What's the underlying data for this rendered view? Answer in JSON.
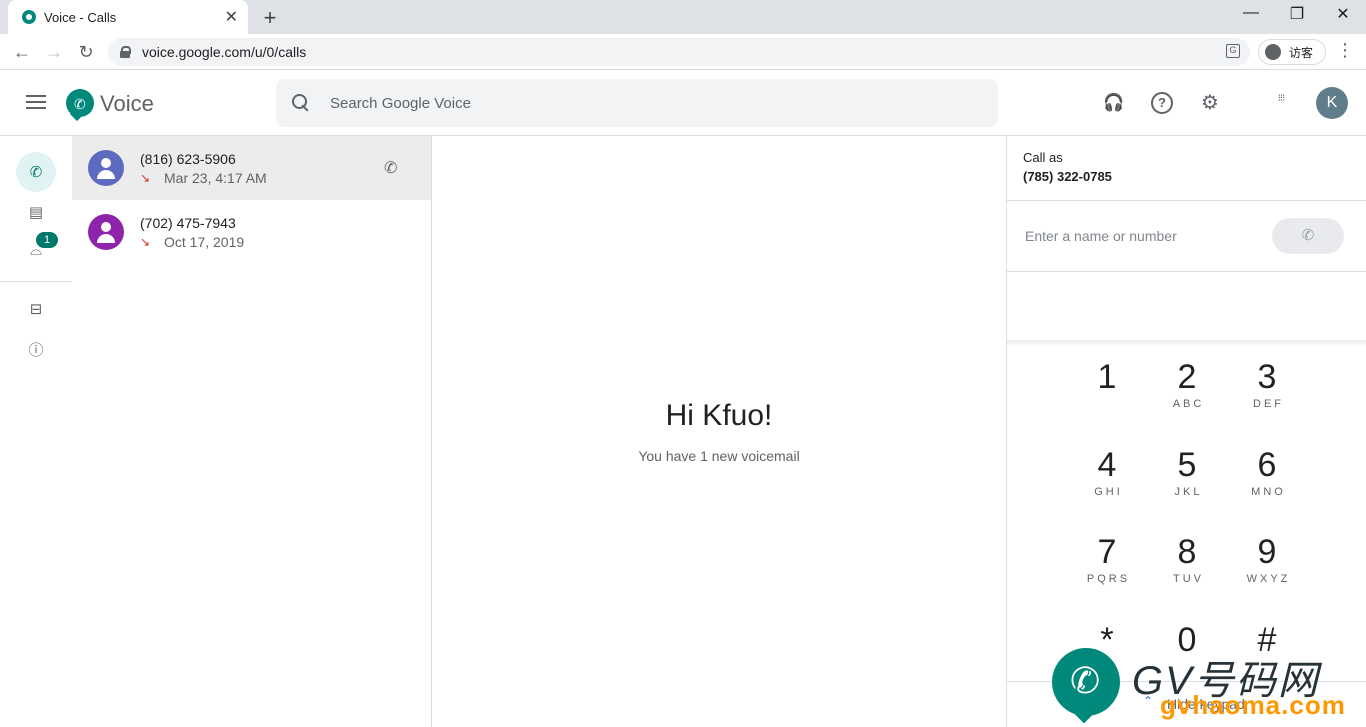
{
  "browser": {
    "tab_title": "Voice - Calls",
    "tab_close": "✕",
    "new_tab": "+",
    "url": "voice.google.com/u/0/calls",
    "profile_label": "访客",
    "minimize": "—",
    "maximize": "❐",
    "close": "✕",
    "back": "←",
    "forward": "→",
    "reload": "↻",
    "menu": "⋮",
    "translate": "G"
  },
  "app": {
    "brand": "Voice",
    "search_placeholder": "Search Google Voice",
    "avatar_initial": "K",
    "help": "?",
    "support_icon": "🎧",
    "settings_icon": "⚙",
    "apps_icon": "⋮⋮⋮"
  },
  "nav": {
    "voicemail_badge": "1",
    "calls_icon": "✆",
    "messages_icon": "▤",
    "voicemail_icon": "⌓",
    "archive_icon": "⊟",
    "spam_icon": "ⓘ"
  },
  "calls": [
    {
      "number": "(816) 623-5906",
      "date": "Mar 23, 4:17 AM",
      "avatar_color": "#5c6bc0",
      "missed_icon": "↘",
      "call_icon": "✆"
    },
    {
      "number": "(702) 475-7943",
      "date": "Oct 17, 2019",
      "avatar_color": "#8e24aa",
      "missed_icon": "↘"
    }
  ],
  "center": {
    "greeting": "Hi Kfuo!",
    "subtext": "You have 1 new voicemail"
  },
  "dialer": {
    "call_as_label": "Call as",
    "call_as_number": "(785) 322-0785",
    "input_placeholder": "Enter a name or number",
    "call_icon": "✆",
    "keys": [
      {
        "digit": "1",
        "letters": ""
      },
      {
        "digit": "2",
        "letters": "ABC"
      },
      {
        "digit": "3",
        "letters": "DEF"
      },
      {
        "digit": "4",
        "letters": "GHI"
      },
      {
        "digit": "5",
        "letters": "JKL"
      },
      {
        "digit": "6",
        "letters": "MNO"
      },
      {
        "digit": "7",
        "letters": "PQRS"
      },
      {
        "digit": "8",
        "letters": "TUV"
      },
      {
        "digit": "9",
        "letters": "WXYZ"
      },
      {
        "digit": "*",
        "letters": ""
      },
      {
        "digit": "0",
        "letters": ""
      },
      {
        "digit": "#",
        "letters": ""
      }
    ],
    "hide_keypad": "Hide keypad",
    "hide_chevron": "⌃"
  },
  "watermark": {
    "line1": "GV号码网",
    "line2": "gvhaoma.com",
    "phone_glyph": "✆"
  },
  "colors": {
    "accent": "#00897b",
    "accent_dark": "#00796b",
    "missed": "#d93025"
  }
}
